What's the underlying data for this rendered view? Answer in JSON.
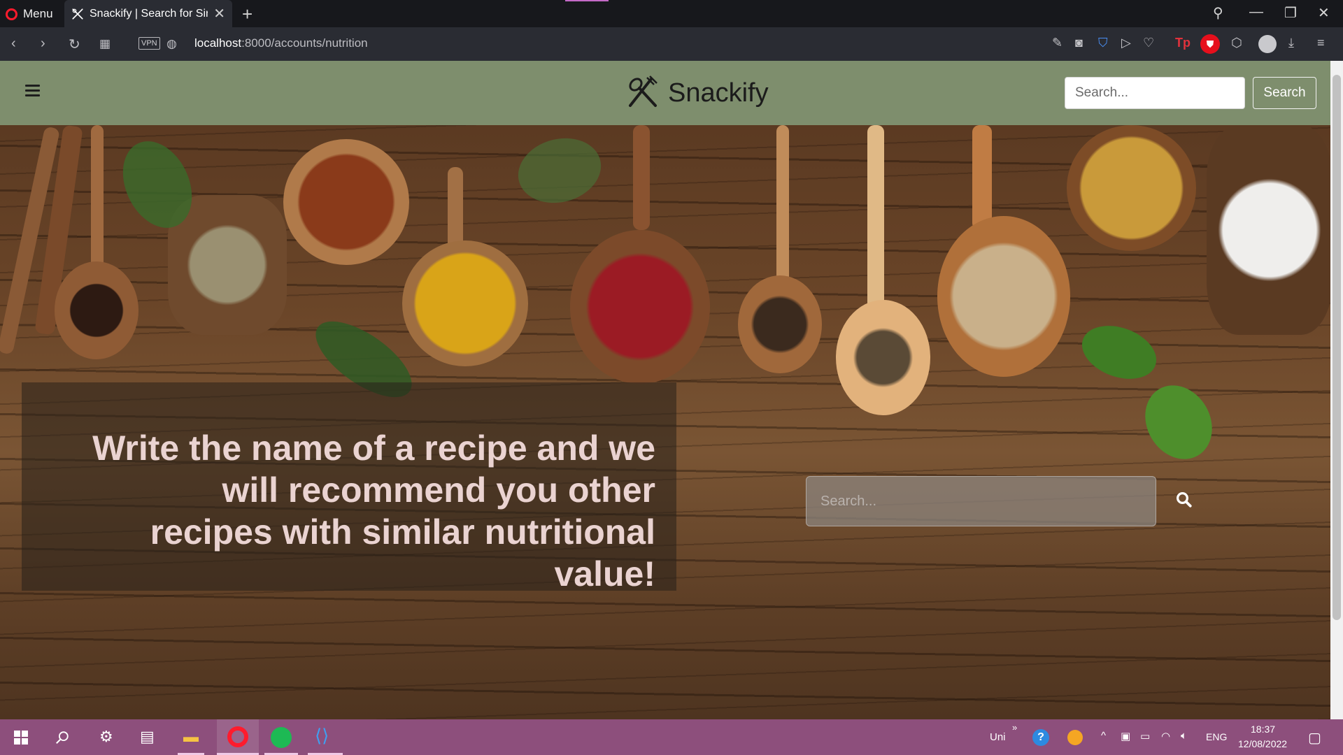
{
  "browser": {
    "menu_label": "Menu",
    "tab_title": "Snackify | Search for Similar",
    "url_host": "localhost",
    "url_path": ":8000/accounts/nutrition",
    "vpn_label": "VPN"
  },
  "navbar": {
    "brand": "Snackify",
    "search_placeholder": "Search...",
    "search_button": "Search"
  },
  "hero": {
    "headline": "Write the name of a recipe and we will recommend you other recipes with similar nutritional value!",
    "search_placeholder": "Search..."
  },
  "taskbar": {
    "uni_label": "Uni",
    "language": "ENG",
    "time": "18:37",
    "date": "12/08/2022"
  },
  "colors": {
    "navbar_bg": "#7e8e6d",
    "taskbar_bg": "#8d4f7c",
    "opera_red": "#ff1b2d",
    "headline_text": "#ead3d1"
  }
}
